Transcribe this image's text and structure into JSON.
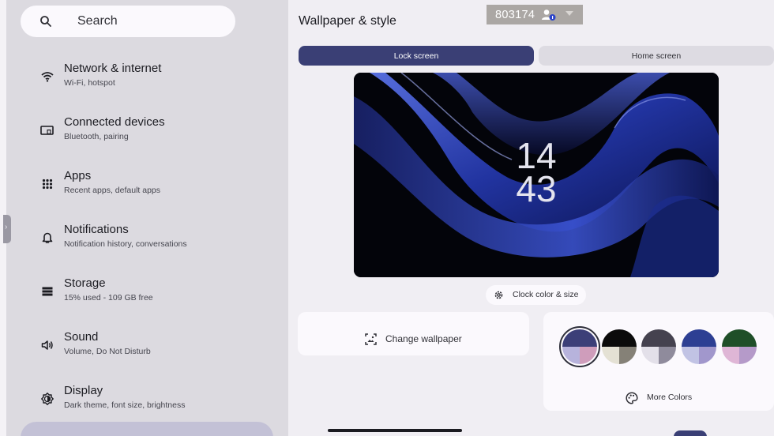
{
  "search": {
    "label": "Search"
  },
  "sidebar": {
    "items": [
      {
        "title": "Network & internet",
        "subtitle": "Wi-Fi, hotspot",
        "icon": "wifi-icon"
      },
      {
        "title": "Connected devices",
        "subtitle": "Bluetooth, pairing",
        "icon": "devices-icon"
      },
      {
        "title": "Apps",
        "subtitle": "Recent apps, default apps",
        "icon": "apps-grid-icon"
      },
      {
        "title": "Notifications",
        "subtitle": "Notification history, conversations",
        "icon": "bell-icon"
      },
      {
        "title": "Storage",
        "subtitle": "15% used - 109 GB free",
        "icon": "storage-icon"
      },
      {
        "title": "Sound",
        "subtitle": "Volume, Do Not Disturb",
        "icon": "speaker-icon"
      },
      {
        "title": "Display",
        "subtitle": "Dark theme, font size, brightness",
        "icon": "brightness-icon"
      }
    ]
  },
  "main": {
    "title": "Wallpaper & style",
    "tabs": [
      {
        "label": "Lock screen",
        "active": true
      },
      {
        "label": "Home screen",
        "active": false
      }
    ],
    "preview": {
      "clock_hours": "14",
      "clock_minutes": "43"
    },
    "clock_button": {
      "label": "Clock color & size",
      "icon": "gear-icon"
    },
    "change_wallpaper": {
      "label": "Change wallpaper",
      "icon": "wallpaper-icon"
    },
    "more_colors": {
      "label": "More Colors",
      "icon": "palette-icon"
    },
    "color_options": [
      {
        "top": "#3c3f78",
        "bottom_left": "#b7b3dc",
        "bottom_right": "#cf9dbb",
        "selected": true
      },
      {
        "top": "#0b0b0b",
        "bottom_left": "#e4e1d4",
        "bottom_right": "#858177",
        "selected": false
      },
      {
        "top": "#45424f",
        "bottom_left": "#e3e0e9",
        "bottom_right": "#8f8b9c",
        "selected": false
      },
      {
        "top": "#2d3f93",
        "bottom_left": "#c1c3e4",
        "bottom_right": "#a197cc",
        "selected": false
      },
      {
        "top": "#1f4f28",
        "bottom_left": "#dfb6d6",
        "bottom_right": "#b59ac9",
        "selected": false
      }
    ]
  },
  "overlay_badge": {
    "number": "803174",
    "icon": "person-icon"
  },
  "colors": {
    "accent": "#3a3f75",
    "sidebar_bg": "#dcdae0",
    "page_bg": "#f0eef3",
    "card_bg": "#fbf9fd"
  }
}
